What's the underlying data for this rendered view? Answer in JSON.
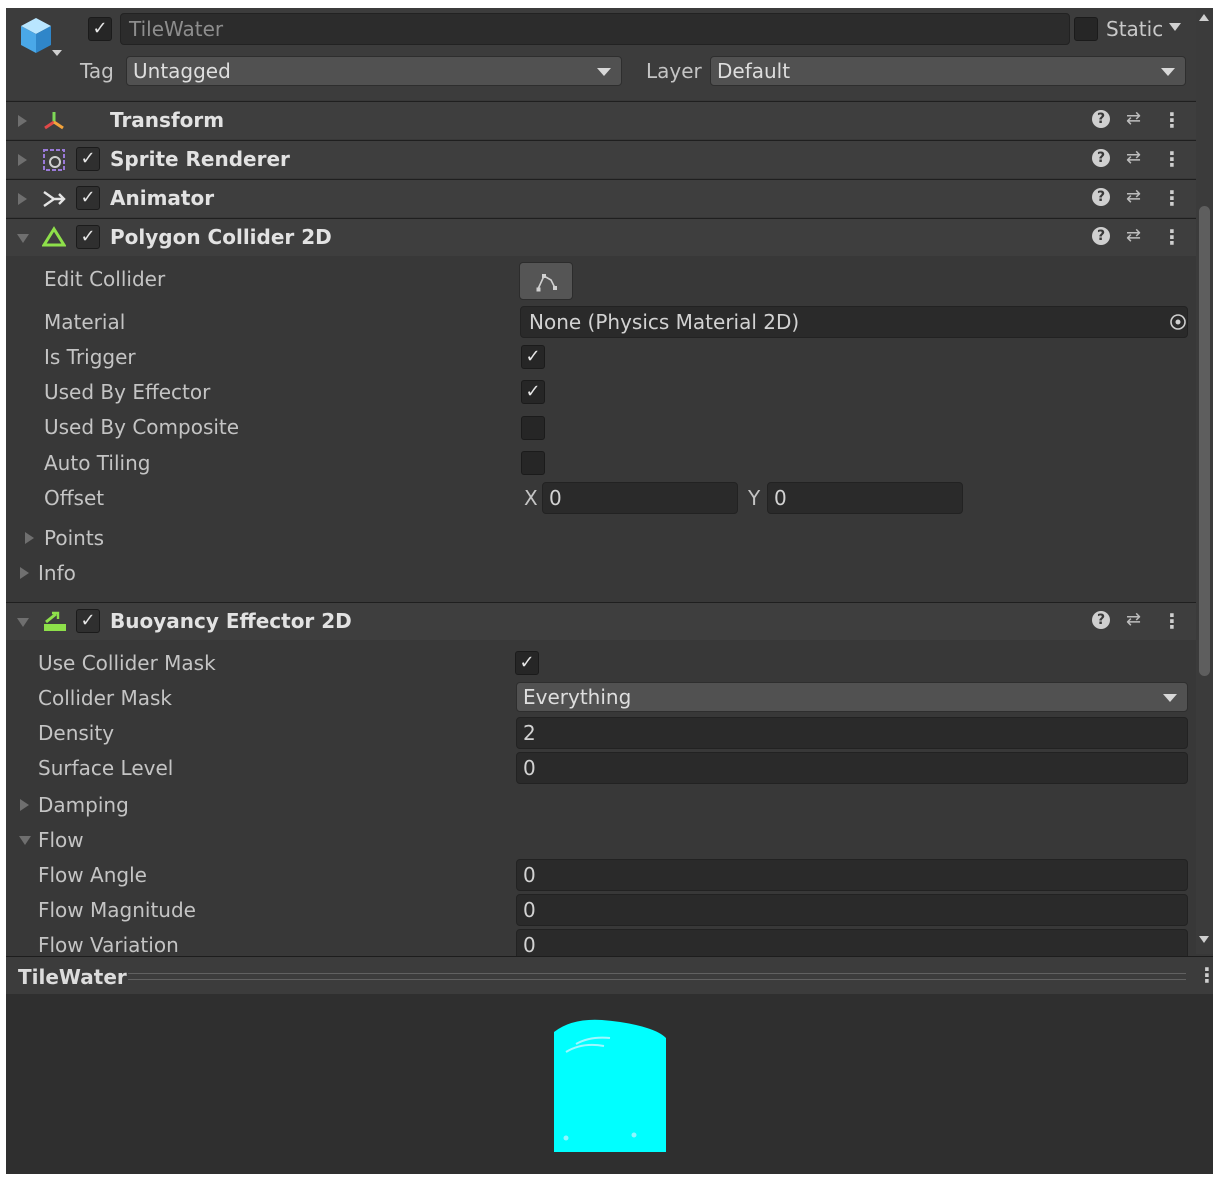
{
  "header": {
    "object_name": "TileWater",
    "active_checked": true,
    "static_label": "Static",
    "tag_label": "Tag",
    "tag_value": "Untagged",
    "layer_label": "Layer",
    "layer_value": "Default"
  },
  "components": {
    "transform": {
      "title": "Transform"
    },
    "sprite_renderer": {
      "title": "Sprite Renderer",
      "enabled": true
    },
    "animator": {
      "title": "Animator",
      "enabled": true
    },
    "polygon_collider": {
      "title": "Polygon Collider 2D",
      "enabled": true,
      "edit_collider_label": "Edit Collider",
      "material_label": "Material",
      "material_value": "None (Physics Material 2D)",
      "is_trigger_label": "Is Trigger",
      "is_trigger": true,
      "used_by_effector_label": "Used By Effector",
      "used_by_effector": true,
      "used_by_composite_label": "Used By Composite",
      "used_by_composite": false,
      "auto_tiling_label": "Auto Tiling",
      "auto_tiling": false,
      "offset_label": "Offset",
      "offset_x_label": "X",
      "offset_x": "0",
      "offset_y_label": "Y",
      "offset_y": "0",
      "points_label": "Points",
      "info_label": "Info"
    },
    "buoyancy_effector": {
      "title": "Buoyancy Effector 2D",
      "enabled": true,
      "use_collider_mask_label": "Use Collider Mask",
      "use_collider_mask": true,
      "collider_mask_label": "Collider Mask",
      "collider_mask_value": "Everything",
      "density_label": "Density",
      "density_value": "2",
      "surface_level_label": "Surface Level",
      "surface_level_value": "0",
      "damping_label": "Damping",
      "flow_label": "Flow",
      "flow_angle_label": "Flow Angle",
      "flow_angle_value": "0",
      "flow_magnitude_label": "Flow Magnitude",
      "flow_magnitude_value": "0",
      "flow_variation_label": "Flow Variation",
      "flow_variation_value": "0"
    }
  },
  "preview": {
    "title": "TileWater",
    "sprite_color": "#00ffff"
  },
  "colors": {
    "panel_bg": "#383838",
    "header_bg": "#3e3e3e",
    "field_bg": "#2a2a2a",
    "accent": "#00ffff"
  },
  "glyphs": {
    "check": "✓",
    "help": "?",
    "preset": "⇄",
    "menu": "⋮"
  }
}
